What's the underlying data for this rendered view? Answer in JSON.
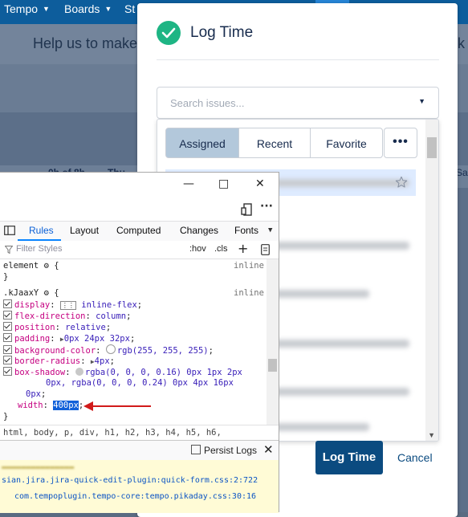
{
  "topnav": {
    "items": [
      {
        "label": "Tempo"
      },
      {
        "label": "Boards"
      },
      {
        "label": "St"
      }
    ]
  },
  "background": {
    "help_text": "Help us to make",
    "trailing_k": "k",
    "hours": "0h of 8h",
    "day": "Thu",
    "sat": "Sa"
  },
  "dialog": {
    "title": "Log Time",
    "search": {
      "placeholder": "Search issues..."
    },
    "tabs": [
      {
        "label": "Assigned",
        "active": true
      },
      {
        "label": "Recent"
      },
      {
        "label": "Favorite"
      },
      {
        "label": "•••"
      }
    ],
    "primary_button": "Log Time",
    "cancel": "Cancel"
  },
  "devtools": {
    "tabs": [
      {
        "label": "Rules",
        "active": true
      },
      {
        "label": "Layout"
      },
      {
        "label": "Computed"
      },
      {
        "label": "Changes"
      },
      {
        "label": "Fonts"
      }
    ],
    "filter_placeholder": "Filter Styles",
    "hov": ":hov",
    "cls": ".cls",
    "rules": {
      "element_selector": "element",
      "inline_label": "inline",
      "kjaaxy_selector": ".kJaaxY",
      "declarations": [
        {
          "name": "display",
          "value": "inline-flex"
        },
        {
          "name": "flex-direction",
          "value": "column"
        },
        {
          "name": "position",
          "value": "relative"
        },
        {
          "name": "padding",
          "value": "0px 24px 32px"
        },
        {
          "name": "background-color",
          "value": "rgb(255, 255, 255)"
        },
        {
          "name": "border-radius",
          "value": "4px"
        },
        {
          "name": "box-shadow",
          "value": "rgba(0, 0, 0, 0.16) 0px 1px 2px"
        },
        {
          "name": "box-shadow-2",
          "value": "0px, rgba(0, 0, 0, 0.24) 0px 4px 16px"
        },
        {
          "name": "box-shadow-3",
          "value": "0px"
        },
        {
          "name": "width",
          "value": "400px"
        }
      ]
    },
    "breadcrumb": "html, body, p, div, h1, h2, h3, h4, h5, h6,",
    "persist_logs": "Persist Logs",
    "console": [
      {
        "text": "sian.jira.jira-quick-edit-plugin:quick-form.css:2:722"
      },
      {
        "text": "com.tempoplugin.tempo-core:tempo.pikaday.css:30:16"
      }
    ]
  },
  "colors": {
    "accent_green": "#1eb584",
    "primary_button": "#0b4b80",
    "active_tab": "#b3c8db",
    "selected_row": "#deebff",
    "nav_bar": "#0d5d9c"
  }
}
